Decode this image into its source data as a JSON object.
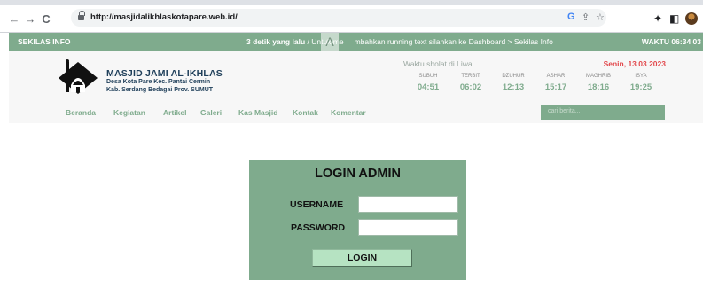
{
  "browser": {
    "url": "http://masjidalikhlaskotapare.web.id/",
    "icons": [
      "back-icon",
      "forward-icon",
      "reload-icon",
      "lock-icon",
      "google-icon",
      "share-icon",
      "star-icon",
      "extensions-icon",
      "sidebar-icon",
      "profile-avatar"
    ],
    "back": "←",
    "forward": "→",
    "reload": "C",
    "google": "G",
    "share": "⇪",
    "star": "☆",
    "extensions": "✦",
    "sidebar": "◧"
  },
  "infobar": {
    "label": "SEKILAS INFO",
    "ticker_time": "3 detik yang lalu",
    "ticker_text": " / Untuk me",
    "ticker_text2": "mbahkan running text silahkan ke Dashboard > Sekilas Info",
    "badge": "A",
    "clock": "WAKTU 06:34 03"
  },
  "mosque": {
    "name": "MASJID JAMI AL-IKHLAS",
    "address_line1": "Desa Kota Pare Kec. Pantai Cermin",
    "address_line2": "Kab. Serdang Bedagai Prov. SUMUT"
  },
  "prayer": {
    "title": "Waktu sholat di Liwa",
    "date": "Senin, 13 03 2023",
    "times": [
      {
        "name": "SUBUH",
        "time": "04:51"
      },
      {
        "name": "TERBIT",
        "time": "06:02"
      },
      {
        "name": "DZUHUR",
        "time": "12:13"
      },
      {
        "name": "ASHAR",
        "time": "15:17"
      },
      {
        "name": "MAGHRIB",
        "time": "18:16"
      },
      {
        "name": "ISYA",
        "time": "19:25"
      }
    ]
  },
  "menu": [
    "Beranda",
    "Kegiatan",
    "Artikel",
    "Galeri",
    "Kas Masjid",
    "Kontak",
    "Komentar"
  ],
  "search": {
    "placeholder": "cari berita..."
  },
  "login": {
    "title": "LOGIN ADMIN",
    "username_label": "USERNAME",
    "password_label": "PASSWORD",
    "button": "LOGIN",
    "username_value": "",
    "password_value": ""
  },
  "colors": {
    "accent": "#7fab8d",
    "date": "#e2474b",
    "title": "#1f3f5a"
  }
}
